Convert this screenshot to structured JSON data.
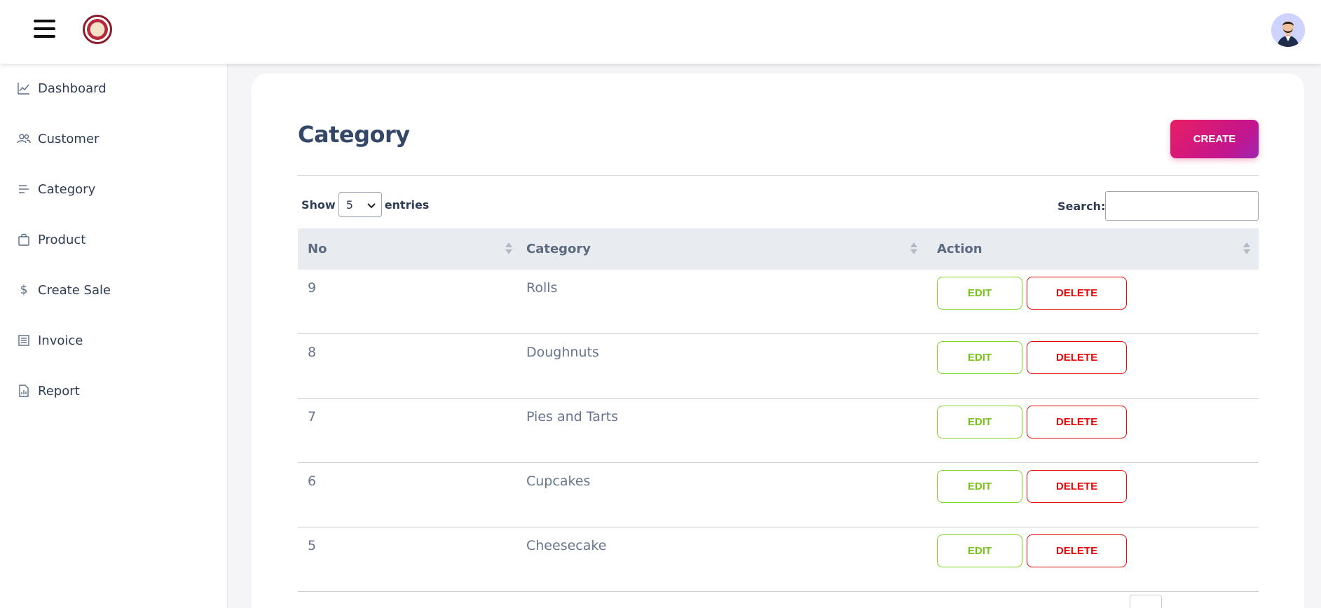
{
  "header": {
    "menu_icon": "hamburger-icon",
    "logo_icon": "bakery-logo",
    "avatar_icon": "user-avatar"
  },
  "sidebar": {
    "items": [
      {
        "label": "Dashboard",
        "icon": "chart-line-icon"
      },
      {
        "label": "Customer",
        "icon": "users-icon"
      },
      {
        "label": "Category",
        "icon": "list-lines-icon"
      },
      {
        "label": "Product",
        "icon": "shopping-bag-icon"
      },
      {
        "label": "Create Sale",
        "icon": "dollar-icon"
      },
      {
        "label": "Invoice",
        "icon": "invoice-icon"
      },
      {
        "label": "Report",
        "icon": "report-file-icon"
      }
    ]
  },
  "main": {
    "title": "Category",
    "create_label": "CREATE",
    "show_label": "Show",
    "entries_value": "5",
    "entries_label": "entries",
    "search_label": "Search:",
    "search_value": "",
    "columns": [
      "No",
      "Category",
      "Action"
    ],
    "rows": [
      {
        "no": "9",
        "category": "Rolls"
      },
      {
        "no": "8",
        "category": "Doughnuts"
      },
      {
        "no": "7",
        "category": "Pies and Tarts"
      },
      {
        "no": "6",
        "category": "Cupcakes"
      },
      {
        "no": "5",
        "category": "Cheesecake"
      }
    ],
    "edit_label": "EDIT",
    "delete_label": "DELETE"
  },
  "colors": {
    "accent_start": "#e91e63",
    "accent_end": "#9c27b0",
    "edit": "#76c41a",
    "delete": "#ea0606"
  }
}
